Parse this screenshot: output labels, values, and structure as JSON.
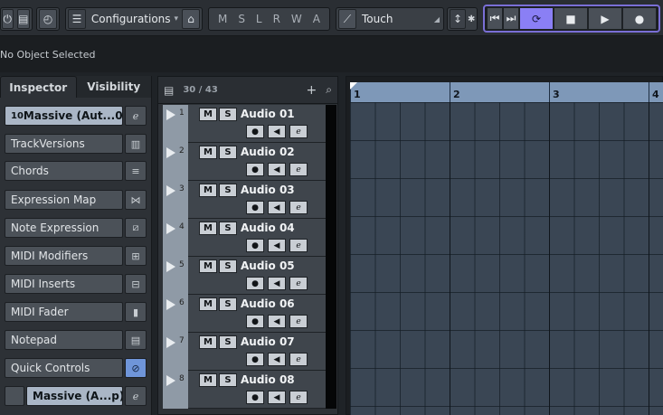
{
  "toolbar": {
    "configurations_label": "Configurations",
    "automation_buttons": [
      "M",
      "S",
      "L",
      "R",
      "W",
      "A"
    ],
    "automation_mode": "Touch"
  },
  "status": {
    "selection_text": "No Object Selected"
  },
  "inspector": {
    "tabs": [
      "Inspector",
      "Visibility"
    ],
    "track_number": "10",
    "track_name": "Massive (Aut...01",
    "items": [
      {
        "label": "TrackVersions"
      },
      {
        "label": "Chords"
      },
      {
        "label": "Expression Map"
      },
      {
        "label": "Note Expression"
      },
      {
        "label": "MIDI Modifiers"
      },
      {
        "label": "MIDI Inserts"
      },
      {
        "label": "MIDI Fader"
      },
      {
        "label": "Notepad"
      },
      {
        "label": "Quick Controls"
      }
    ],
    "instrument_name": "Massive (A...p)"
  },
  "tracklist": {
    "count": "30 / 43",
    "tracks": [
      {
        "num": "1",
        "name": "Audio 01"
      },
      {
        "num": "2",
        "name": "Audio 02"
      },
      {
        "num": "3",
        "name": "Audio 03"
      },
      {
        "num": "4",
        "name": "Audio 04"
      },
      {
        "num": "5",
        "name": "Audio 05"
      },
      {
        "num": "6",
        "name": "Audio 06"
      },
      {
        "num": "7",
        "name": "Audio 07"
      },
      {
        "num": "8",
        "name": "Audio 08"
      }
    ],
    "m_label": "M",
    "s_label": "S"
  },
  "ruler": {
    "bars": [
      "1",
      "2",
      "3",
      "4"
    ]
  }
}
